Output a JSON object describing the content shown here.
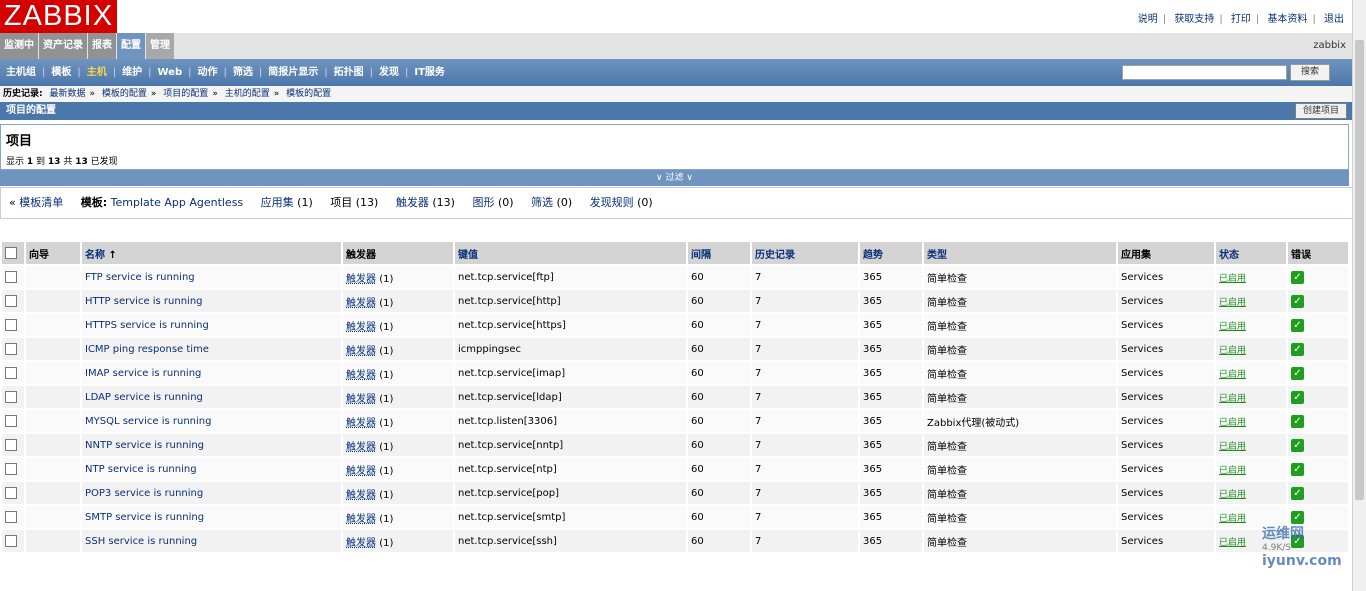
{
  "logo": "ZABBIX",
  "top_links": [
    "说明",
    "获取支持",
    "打印",
    "基本资料",
    "退出"
  ],
  "username": "zabbix",
  "menu1": [
    "监测中",
    "资产记录",
    "报表",
    "配置",
    "管理"
  ],
  "menu1_active": 3,
  "menu2": [
    "主机组",
    "模板",
    "主机",
    "维护",
    "Web",
    "动作",
    "筛选",
    "简报片显示",
    "拓扑图",
    "发现",
    "IT服务"
  ],
  "menu2_selected": 2,
  "search_button": "搜索",
  "history": {
    "label": "历史记录:",
    "items": [
      "最新数据",
      "模板的配置",
      "项目的配置",
      "主机的配置",
      "模板的配置"
    ]
  },
  "section_title": "项目的配置",
  "create_button": "创建项目",
  "item_title": "项目",
  "showing": {
    "pre": "显示",
    "from": "1",
    "to_label": "到",
    "to": "13",
    "of_label": "共",
    "total": "13",
    "post": "已发现"
  },
  "filter_label": "过滤",
  "crumb": {
    "back": "模板清单",
    "template_label": "模板:",
    "template_name": "Template App Agentless",
    "apps": "应用集",
    "apps_count": "(1)",
    "items": "项目",
    "items_count": "(13)",
    "triggers": "触发器",
    "triggers_count": "(13)",
    "graphs": "图形",
    "graphs_count": "(0)",
    "screens": "筛选",
    "screens_count": "(0)",
    "discovery": "发现规则",
    "discovery_count": "(0)"
  },
  "columns": [
    "向导",
    "名称",
    "触发器",
    "键值",
    "间隔",
    "历史记录",
    "趋势",
    "类型",
    "应用集",
    "状态",
    "错误"
  ],
  "rows": [
    {
      "name": "FTP service is running",
      "trig": "触发器",
      "trig_count": "(1)",
      "key": "net.tcp.service[ftp]",
      "interval": "60",
      "history": "7",
      "trends": "365",
      "type": "简单检查",
      "app": "Services",
      "status": "已启用"
    },
    {
      "name": "HTTP service is running",
      "trig": "触发器",
      "trig_count": "(1)",
      "key": "net.tcp.service[http]",
      "interval": "60",
      "history": "7",
      "trends": "365",
      "type": "简单检查",
      "app": "Services",
      "status": "已启用"
    },
    {
      "name": "HTTPS service is running",
      "trig": "触发器",
      "trig_count": "(1)",
      "key": "net.tcp.service[https]",
      "interval": "60",
      "history": "7",
      "trends": "365",
      "type": "简单检查",
      "app": "Services",
      "status": "已启用"
    },
    {
      "name": "ICMP ping response time",
      "trig": "触发器",
      "trig_count": "(1)",
      "key": "icmppingsec",
      "interval": "60",
      "history": "7",
      "trends": "365",
      "type": "简单检查",
      "app": "Services",
      "status": "已启用"
    },
    {
      "name": "IMAP service is running",
      "trig": "触发器",
      "trig_count": "(1)",
      "key": "net.tcp.service[imap]",
      "interval": "60",
      "history": "7",
      "trends": "365",
      "type": "简单检查",
      "app": "Services",
      "status": "已启用"
    },
    {
      "name": "LDAP service is running",
      "trig": "触发器",
      "trig_count": "(1)",
      "key": "net.tcp.service[ldap]",
      "interval": "60",
      "history": "7",
      "trends": "365",
      "type": "简单检查",
      "app": "Services",
      "status": "已启用"
    },
    {
      "name": "MYSQL service is running",
      "trig": "触发器",
      "trig_count": "(1)",
      "key": "net.tcp.listen[3306]",
      "interval": "60",
      "history": "7",
      "trends": "365",
      "type": "Zabbix代理(被动式)",
      "app": "Services",
      "status": "已启用"
    },
    {
      "name": "NNTP service is running",
      "trig": "触发器",
      "trig_count": "(1)",
      "key": "net.tcp.service[nntp]",
      "interval": "60",
      "history": "7",
      "trends": "365",
      "type": "简单检查",
      "app": "Services",
      "status": "已启用"
    },
    {
      "name": "NTP service is running",
      "trig": "触发器",
      "trig_count": "(1)",
      "key": "net.tcp.service[ntp]",
      "interval": "60",
      "history": "7",
      "trends": "365",
      "type": "简单检查",
      "app": "Services",
      "status": "已启用"
    },
    {
      "name": "POP3 service is running",
      "trig": "触发器",
      "trig_count": "(1)",
      "key": "net.tcp.service[pop]",
      "interval": "60",
      "history": "7",
      "trends": "365",
      "type": "简单检查",
      "app": "Services",
      "status": "已启用"
    },
    {
      "name": "SMTP service is running",
      "trig": "触发器",
      "trig_count": "(1)",
      "key": "net.tcp.service[smtp]",
      "interval": "60",
      "history": "7",
      "trends": "365",
      "type": "简单检查",
      "app": "Services",
      "status": "已启用"
    },
    {
      "name": "SSH service is running",
      "trig": "触发器",
      "trig_count": "(1)",
      "key": "net.tcp.service[ssh]",
      "interval": "60",
      "history": "7",
      "trends": "365",
      "type": "简单检查",
      "app": "Services",
      "status": "已启用"
    }
  ],
  "watermark": {
    "site": "运维网",
    "url": "iyunv.com",
    "speed": "4.9K/S"
  }
}
